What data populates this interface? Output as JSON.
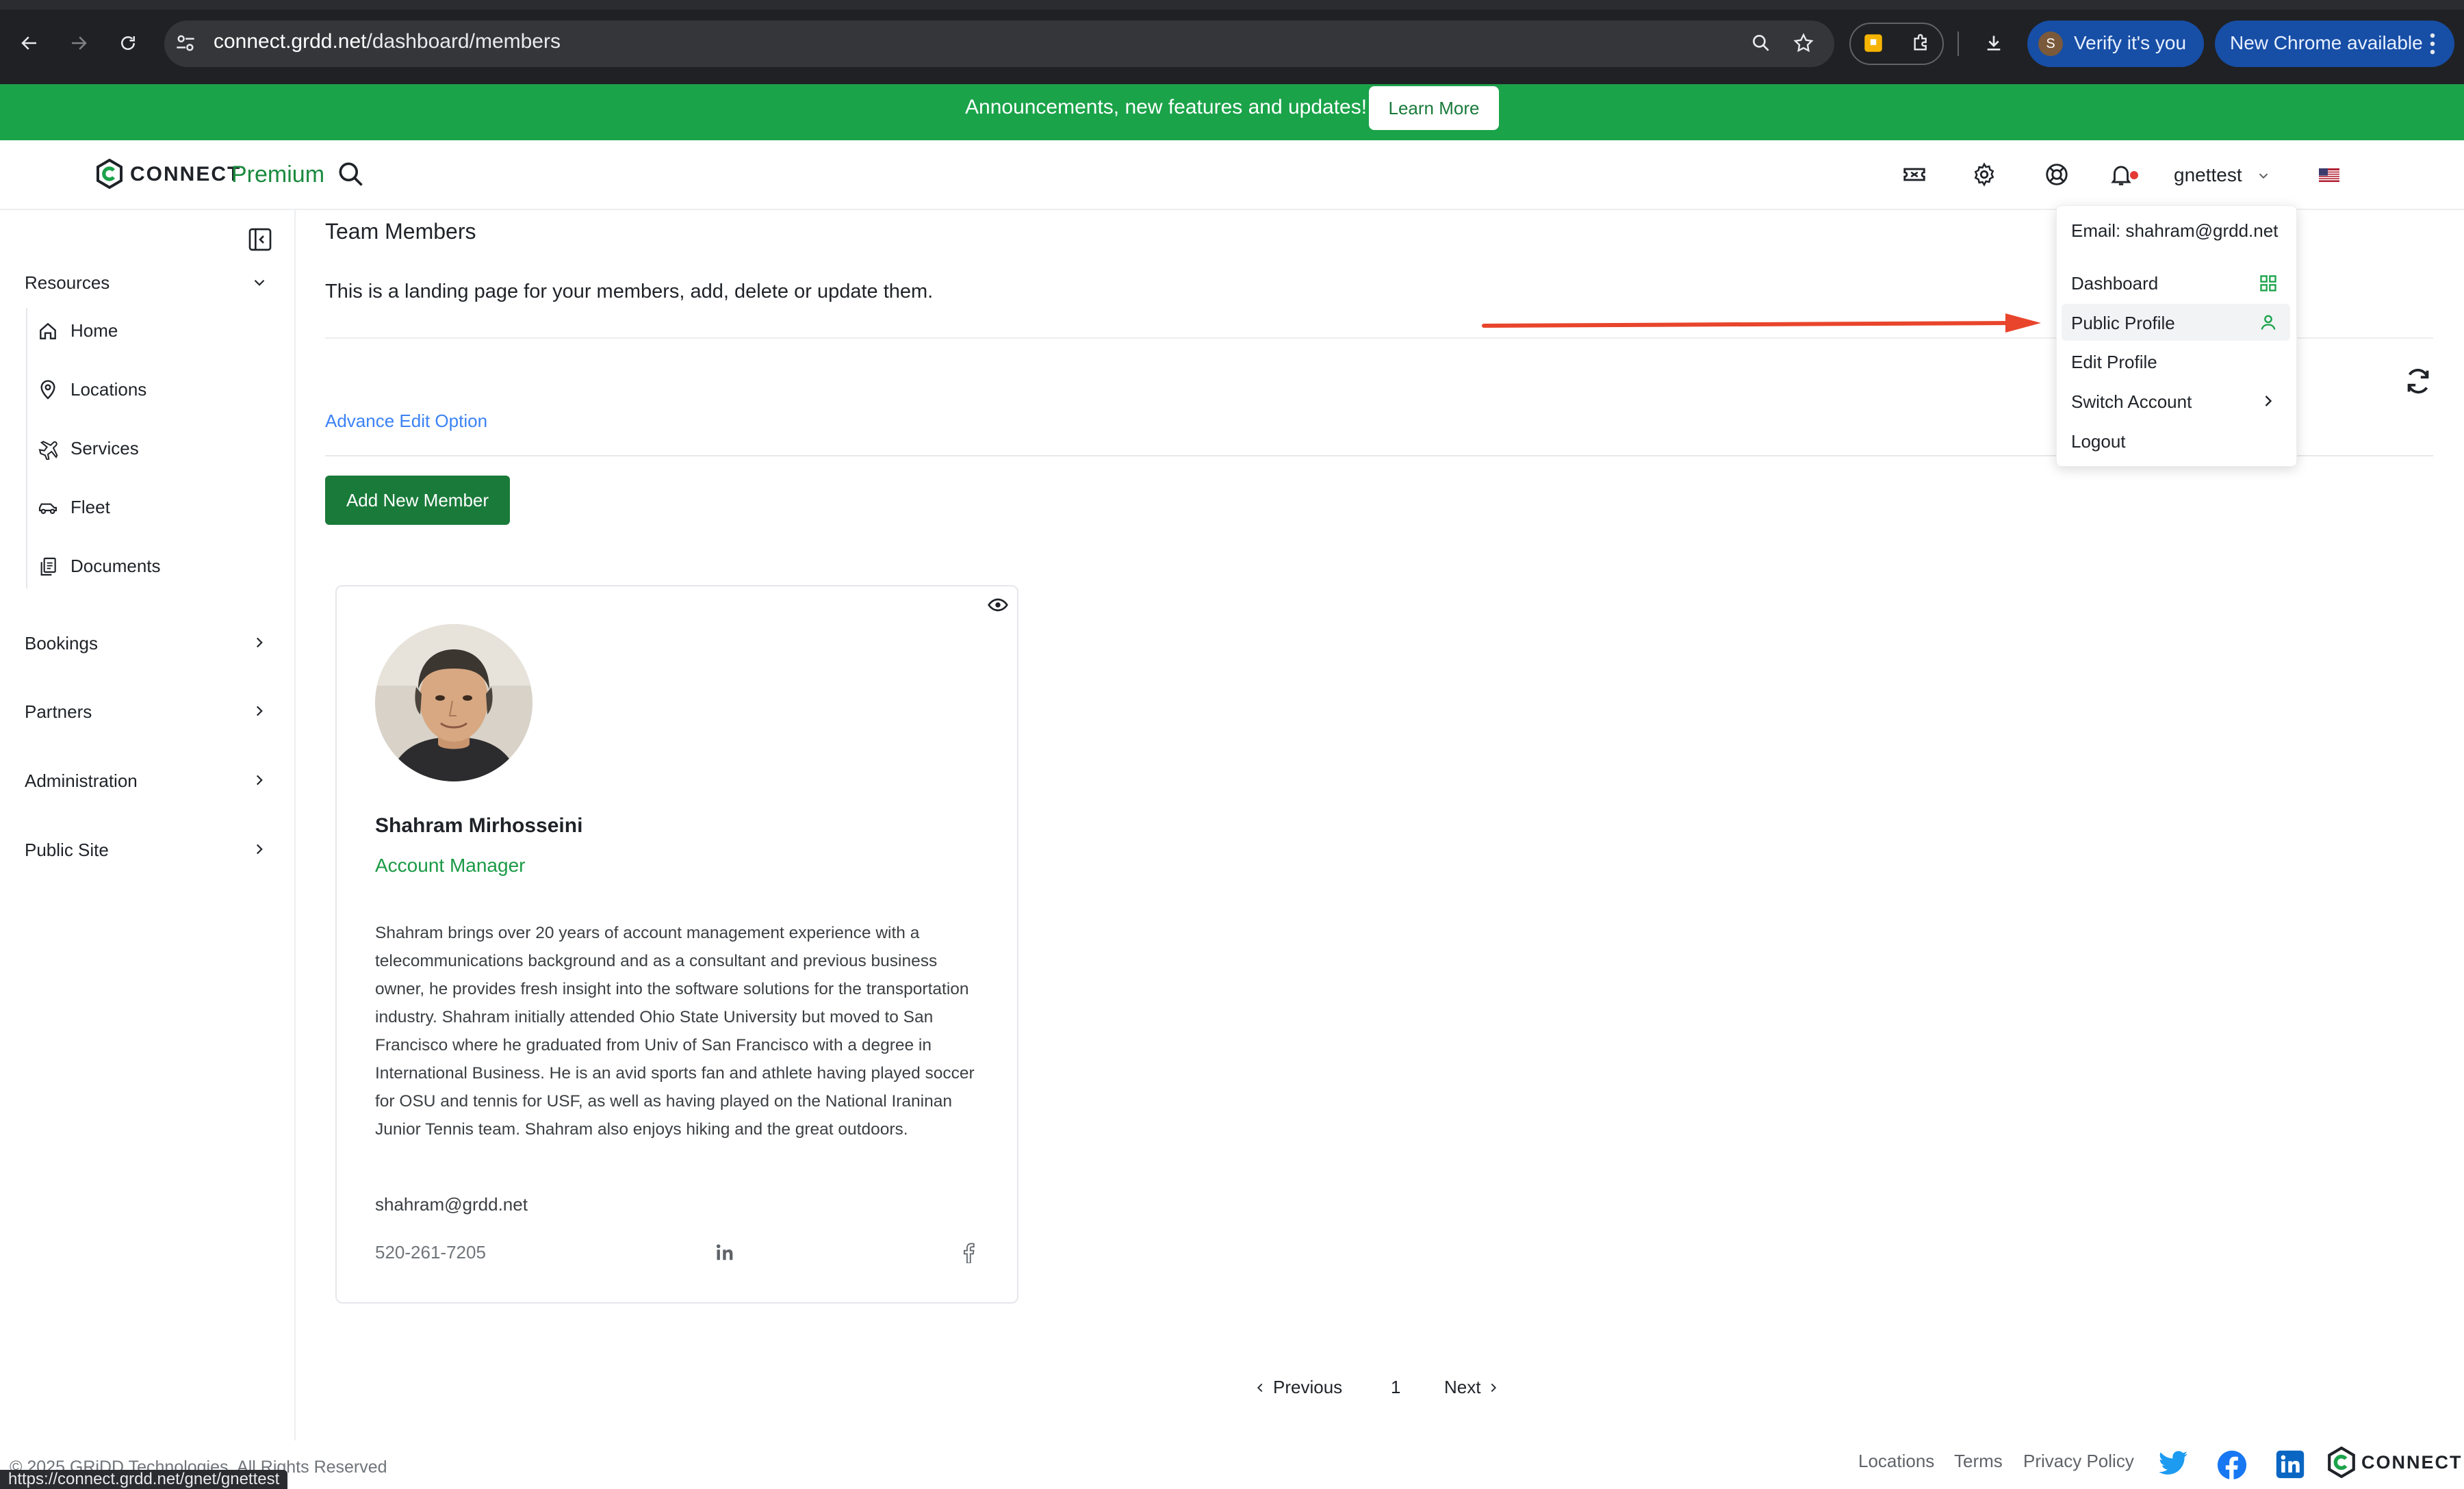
{
  "browser": {
    "url_host": "connect.grdd.net",
    "url_path": "/dashboard/members",
    "verify_label": "Verify it's you",
    "verify_avatar_letter": "S",
    "update_label": "New Chrome available"
  },
  "announcement": {
    "text": "Announcements, new features and updates!",
    "button_label": "Learn More"
  },
  "header": {
    "logo_text": "CONNECT",
    "logo_tier": "Premium",
    "user_name": "gnettest"
  },
  "sidebar": {
    "resources_label": "Resources",
    "resource_items": [
      {
        "label": "Home",
        "icon": "home-icon"
      },
      {
        "label": "Locations",
        "icon": "map-pin-icon"
      },
      {
        "label": "Services",
        "icon": "plane-icon"
      },
      {
        "label": "Fleet",
        "icon": "car-icon"
      },
      {
        "label": "Documents",
        "icon": "documents-icon"
      }
    ],
    "sections": [
      {
        "label": "Bookings"
      },
      {
        "label": "Partners"
      },
      {
        "label": "Administration"
      },
      {
        "label": "Public Site"
      }
    ]
  },
  "main": {
    "title": "Team Members",
    "description": "This is a landing page for your members, add, delete or update them.",
    "advanced_edit_label": "Advance Edit Option",
    "add_member_label": "Add New Member"
  },
  "member": {
    "name": "Shahram Mirhosseini",
    "role": "Account Manager",
    "bio": "Shahram brings over 20 years of account management experience with a telecommunications background and as a consultant and previous business owner, he provides fresh insight into the software solutions for the transportation industry. Shahram initially attended Ohio State University but moved to San Francisco where he graduated from Univ of San Francisco with a degree in International Business. He is an avid sports fan and athlete having played soccer for OSU and tennis for USF, as well as having played on the National Iraninan Junior Tennis team. Shahram also enjoys hiking and the great outdoors.",
    "email": "shahram@grdd.net",
    "phone": "520-261-7205"
  },
  "pagination": {
    "prev_label": "Previous",
    "current_page": "1",
    "next_label": "Next"
  },
  "footer": {
    "copyright": "© 2025 GRiDD Technologies. All Rights Reserved",
    "status_url": "https://connect.grdd.net/gnet/gnettest",
    "links": [
      "Locations",
      "Terms",
      "Privacy Policy"
    ],
    "logo_text": "CONNECT"
  },
  "dropdown": {
    "email_line": "Email: shahram@grdd.net",
    "items": [
      {
        "label": "Dashboard",
        "icon": "dashboard-grid-icon"
      },
      {
        "label": "Public Profile",
        "icon": "user-icon"
      },
      {
        "label": "Edit Profile"
      },
      {
        "label": "Switch Account",
        "icon": "chevron-right-icon"
      },
      {
        "label": "Logout"
      }
    ]
  },
  "colors": {
    "brand_green": "#1ba34a",
    "button_green": "#1a7a3a",
    "link_blue": "#3b82f6",
    "annotation_red": "#e8452c",
    "chrome_pill_blue": "#174ea6"
  }
}
